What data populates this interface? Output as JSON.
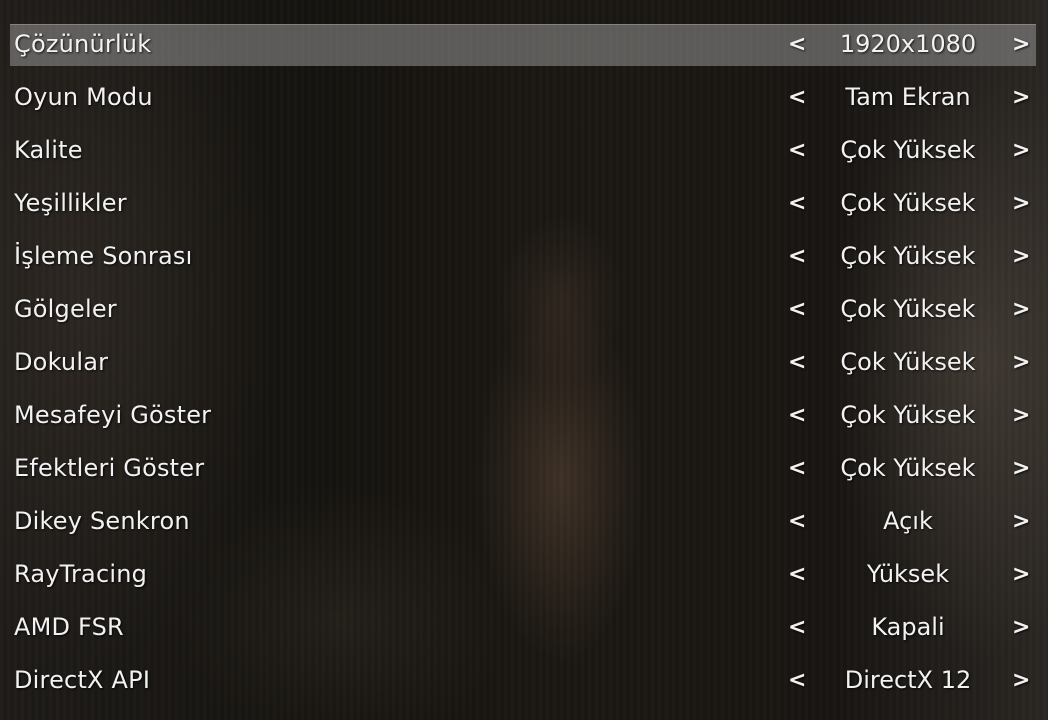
{
  "settings": [
    {
      "label": "Çözünürlük",
      "value": "1920x1080",
      "selected": true
    },
    {
      "label": "Oyun Modu",
      "value": "Tam Ekran"
    },
    {
      "label": "Kalite",
      "value": "Çok Yüksek"
    },
    {
      "label": "Yeşillikler",
      "value": "Çok Yüksek"
    },
    {
      "label": "İşleme Sonrası",
      "value": "Çok Yüksek"
    },
    {
      "label": "Gölgeler",
      "value": "Çok Yüksek"
    },
    {
      "label": "Dokular",
      "value": "Çok Yüksek"
    },
    {
      "label": "Mesafeyi Göster",
      "value": "Çok Yüksek"
    },
    {
      "label": "Efektleri Göster",
      "value": "Çok Yüksek"
    },
    {
      "label": "Dikey Senkron",
      "value": "Açık"
    },
    {
      "label": "RayTracing",
      "value": "Yüksek"
    },
    {
      "label": "AMD FSR",
      "value": "Kapali"
    },
    {
      "label": "DirectX API",
      "value": "DirectX 12"
    }
  ],
  "arrows": {
    "left": "<",
    "right": ">"
  },
  "colors": {
    "text": "#f2f2f2",
    "highlight": "#8c8c8c"
  }
}
